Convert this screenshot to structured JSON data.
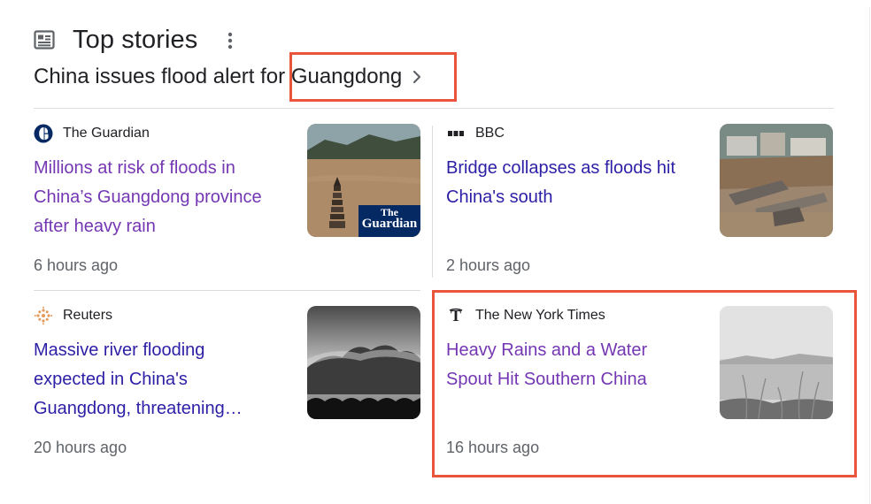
{
  "header": {
    "title": "Top stories",
    "icon": "news-icon",
    "more_icon": "more-vert-icon"
  },
  "topic": {
    "text": "China issues flood alert for Guangdong",
    "chevron_icon": "chevron-right-icon"
  },
  "highlight_color": "#e8553b",
  "stories": [
    {
      "source": "The Guardian",
      "logo_icon": "guardian-logo-icon",
      "headline": "Millions at risk of floods in China’s Guangdong province after heavy rain",
      "time": "6 hours ago",
      "visited": true,
      "thumb_brand": {
        "line1": "The",
        "line2": "Guardian"
      }
    },
    {
      "source": "BBC",
      "logo_icon": "bbc-logo-icon",
      "headline": "Bridge collapses as floods hit China's south",
      "time": "2 hours ago",
      "visited": false
    },
    {
      "source": "Reuters",
      "logo_icon": "reuters-logo-icon",
      "headline": "Massive river flooding expected in China's Guangdong, threatening…",
      "time": "20 hours ago",
      "visited": false
    },
    {
      "source": "The New York Times",
      "logo_icon": "nyt-logo-icon",
      "headline": "Heavy Rains and a Water Spout Hit Southern China",
      "time": "16 hours ago",
      "visited": true
    }
  ]
}
